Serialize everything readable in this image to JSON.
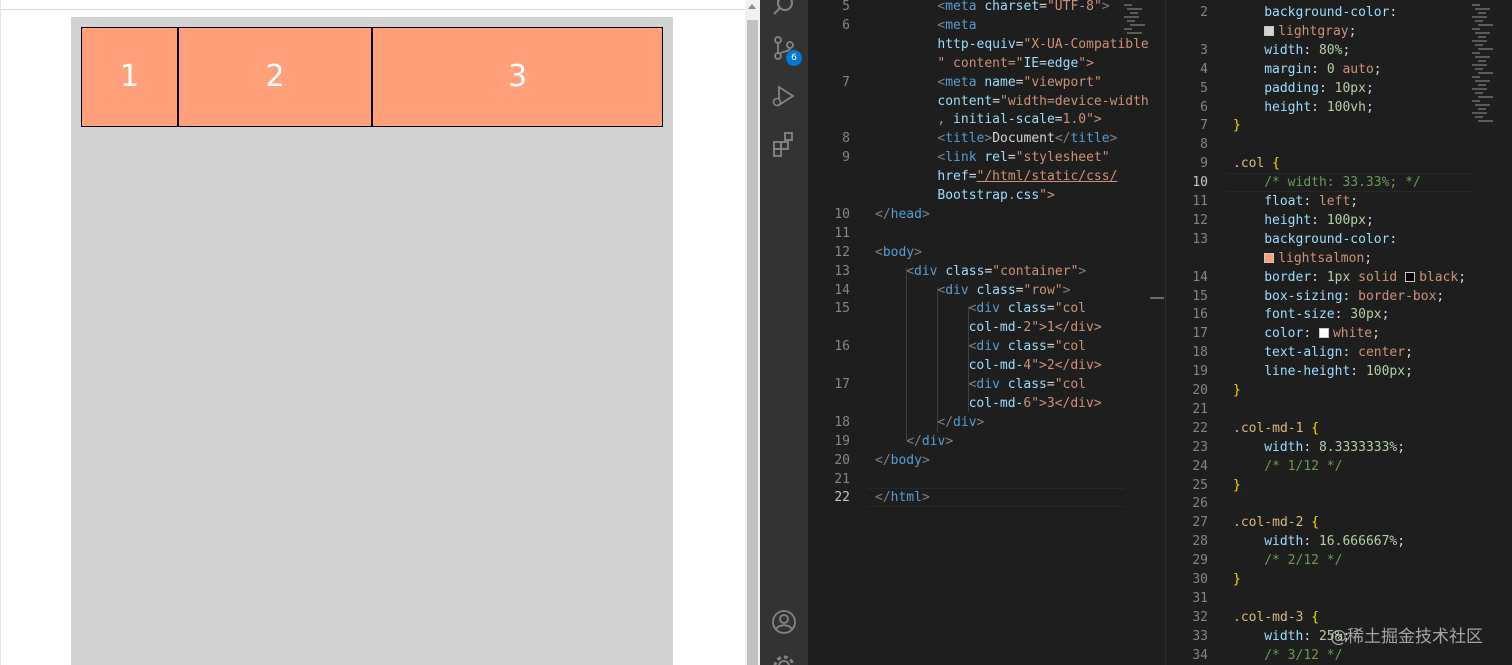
{
  "browser": {
    "columns": [
      {
        "label": "1",
        "width_cols": 2
      },
      {
        "label": "2",
        "width_cols": 4
      },
      {
        "label": "3",
        "width_cols": 6
      }
    ],
    "colors": {
      "container": "#d3d3d3",
      "col": "#ffa07a",
      "col_text": "#ffffff"
    }
  },
  "activity_bar": {
    "items": [
      {
        "name": "search-icon"
      },
      {
        "name": "source-control-icon",
        "badge": "6"
      },
      {
        "name": "run-debug-icon"
      },
      {
        "name": "extensions-icon"
      },
      {
        "name": "account-icon"
      },
      {
        "name": "settings-gear-icon"
      }
    ]
  },
  "html_editor": {
    "current_line": "22",
    "lines": [
      {
        "n": "5",
        "code": "<meta charset=\"UTF-8\">"
      },
      {
        "n": "6",
        "code": "<meta"
      },
      {
        "n": "",
        "code": "http-equiv=\"X-UA-Compatible"
      },
      {
        "n": "",
        "code": "\" content=\"IE=edge\">"
      },
      {
        "n": "7",
        "code": "<meta name=\"viewport\""
      },
      {
        "n": "",
        "code": "content=\"width=device-width"
      },
      {
        "n": "",
        "code": ", initial-scale=1.0\">"
      },
      {
        "n": "8",
        "code": "<title>Document</title>"
      },
      {
        "n": "9",
        "code": "<link rel=\"stylesheet\""
      },
      {
        "n": "",
        "code": "href=\"/html/static/css/"
      },
      {
        "n": "",
        "code": "Bootstrap.css\">"
      },
      {
        "n": "10",
        "code": "</head>"
      },
      {
        "n": "11",
        "code": ""
      },
      {
        "n": "12",
        "code": "<body>"
      },
      {
        "n": "13",
        "code": "<div class=\"container\">"
      },
      {
        "n": "14",
        "code": "<div class=\"row\">"
      },
      {
        "n": "15",
        "code": "<div class=\"col"
      },
      {
        "n": "",
        "code": "col-md-2\">1</div>"
      },
      {
        "n": "16",
        "code": "<div class=\"col"
      },
      {
        "n": "",
        "code": "col-md-4\">2</div>"
      },
      {
        "n": "17",
        "code": "<div class=\"col"
      },
      {
        "n": "",
        "code": "col-md-6\">3</div>"
      },
      {
        "n": "18",
        "code": "</div>"
      },
      {
        "n": "19",
        "code": "</div>"
      },
      {
        "n": "20",
        "code": "</body>"
      },
      {
        "n": "21",
        "code": ""
      },
      {
        "n": "22",
        "code": "</html>"
      }
    ]
  },
  "css_editor": {
    "current_line": "10",
    "lines": [
      {
        "n": "2",
        "code": "background-color:"
      },
      {
        "n": "",
        "code": "lightgray;"
      },
      {
        "n": "3",
        "code": "width: 80%;"
      },
      {
        "n": "4",
        "code": "margin: 0 auto;"
      },
      {
        "n": "5",
        "code": "padding: 10px;"
      },
      {
        "n": "6",
        "code": "height: 100vh;"
      },
      {
        "n": "7",
        "code": "}"
      },
      {
        "n": "8",
        "code": ""
      },
      {
        "n": "9",
        "code": ".col {"
      },
      {
        "n": "10",
        "code": "/* width: 33.33%; */"
      },
      {
        "n": "11",
        "code": "float: left;"
      },
      {
        "n": "12",
        "code": "height: 100px;"
      },
      {
        "n": "13",
        "code": "background-color:"
      },
      {
        "n": "",
        "code": "lightsalmon;"
      },
      {
        "n": "14",
        "code": "border: 1px solid black;"
      },
      {
        "n": "15",
        "code": "box-sizing: border-box;"
      },
      {
        "n": "16",
        "code": "font-size: 30px;"
      },
      {
        "n": "17",
        "code": "color: white;"
      },
      {
        "n": "18",
        "code": "text-align: center;"
      },
      {
        "n": "19",
        "code": "line-height: 100px;"
      },
      {
        "n": "20",
        "code": "}"
      },
      {
        "n": "21",
        "code": ""
      },
      {
        "n": "22",
        "code": ".col-md-1 {"
      },
      {
        "n": "23",
        "code": "width: 8.3333333%;"
      },
      {
        "n": "24",
        "code": "/* 1/12 */"
      },
      {
        "n": "25",
        "code": "}"
      },
      {
        "n": "26",
        "code": ""
      },
      {
        "n": "27",
        "code": ".col-md-2 {"
      },
      {
        "n": "28",
        "code": "width: 16.666667%;"
      },
      {
        "n": "29",
        "code": "/* 2/12 */"
      },
      {
        "n": "30",
        "code": "}"
      },
      {
        "n": "31",
        "code": ""
      },
      {
        "n": "32",
        "code": ".col-md-3 {"
      },
      {
        "n": "33",
        "code": "width: 25%;"
      },
      {
        "n": "34",
        "code": "/* 3/12 */"
      }
    ]
  },
  "watermark": "@稀土掘金技术社区"
}
